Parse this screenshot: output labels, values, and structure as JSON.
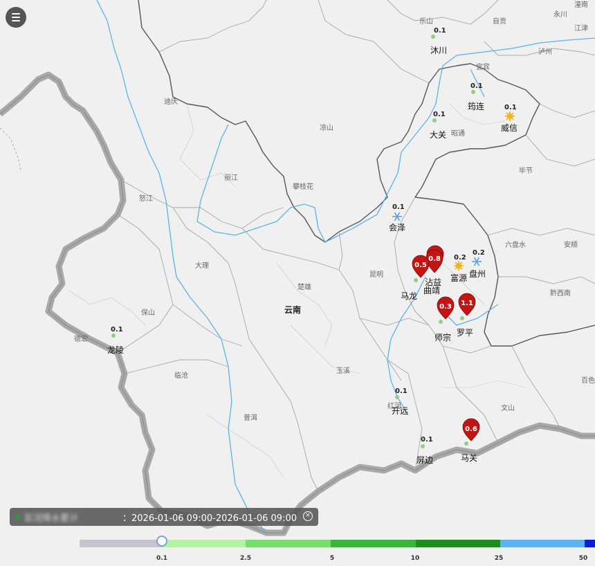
{
  "map": {
    "province_label": "云南",
    "region_labels": [
      {
        "id": "leshan",
        "text": "乐山"
      },
      {
        "id": "zigong",
        "text": "自贡"
      },
      {
        "id": "yongchuan",
        "text": "永川"
      },
      {
        "id": "jiangjin",
        "text": "江津"
      },
      {
        "id": "tongliang",
        "text": "潼南"
      },
      {
        "id": "luzhou",
        "text": "泸州"
      },
      {
        "id": "yibin",
        "text": "宜宾"
      },
      {
        "id": "deqin",
        "text": "迪庆"
      },
      {
        "id": "liangshan",
        "text": "凉山"
      },
      {
        "id": "zhaotong",
        "text": "昭通"
      },
      {
        "id": "bijie",
        "text": "毕节"
      },
      {
        "id": "lijiang",
        "text": "丽江"
      },
      {
        "id": "panzhihua",
        "text": "攀枝花"
      },
      {
        "id": "nujiang",
        "text": "怒江"
      },
      {
        "id": "liupanshui",
        "text": "六盘水"
      },
      {
        "id": "anshun",
        "text": "安顺"
      },
      {
        "id": "dali",
        "text": "大理"
      },
      {
        "id": "chuxiong",
        "text": "楚雄"
      },
      {
        "id": "kunming",
        "text": "昆明"
      },
      {
        "id": "qianxinan",
        "text": "黔西南"
      },
      {
        "id": "dehong",
        "text": "德宏"
      },
      {
        "id": "baoshan",
        "text": "保山"
      },
      {
        "id": "lincang",
        "text": "临沧"
      },
      {
        "id": "yuxi",
        "text": "玉溪"
      },
      {
        "id": "honghe",
        "text": "红河"
      },
      {
        "id": "puer",
        "text": "普洱"
      },
      {
        "id": "wenshan",
        "text": "文山"
      },
      {
        "id": "baise",
        "text": "百色"
      }
    ],
    "stations": [
      {
        "id": "muchuan",
        "name": "沐川",
        "value": "0.1",
        "marker": "dot"
      },
      {
        "id": "junlian",
        "name": "筠连",
        "value": "0.1",
        "marker": "dot"
      },
      {
        "id": "weixin",
        "name": "威信",
        "value": "0.1",
        "marker": "sun"
      },
      {
        "id": "daguan",
        "name": "大关",
        "value": "0.1",
        "marker": "dot"
      },
      {
        "id": "huize",
        "name": "会泽",
        "value": "0.1",
        "marker": "snow"
      },
      {
        "id": "fuyuan",
        "name": "富源",
        "value": "0.2",
        "marker": "sun"
      },
      {
        "id": "panzhou",
        "name": "盘州",
        "value": "0.2",
        "marker": "snow"
      },
      {
        "id": "zhanyi",
        "name": "沾益",
        "value": "0.8",
        "marker": "pin"
      },
      {
        "id": "qujing",
        "name": "曲靖",
        "value": "",
        "marker": "pin"
      },
      {
        "id": "malong",
        "name": "马龙",
        "value": "0.5",
        "marker": "pin"
      },
      {
        "id": "shizong",
        "name": "师宗",
        "value": "0.3",
        "marker": "pin"
      },
      {
        "id": "luoping",
        "name": "罗平",
        "value": "1.1",
        "marker": "pin"
      },
      {
        "id": "longling",
        "name": "龙陵",
        "value": "0.1",
        "marker": "dot"
      },
      {
        "id": "kaiyuan",
        "name": "开远",
        "value": "0.1",
        "marker": "dot"
      },
      {
        "id": "pingbian",
        "name": "屏边",
        "value": "0.1",
        "marker": "dot"
      },
      {
        "id": "maguan",
        "name": "马关",
        "value": "0.6",
        "marker": "pin"
      }
    ]
  },
  "status": {
    "label": "实况降水累计",
    "time_range": "：2026-01-06 09:00-2026-01-06 09:00"
  },
  "legend": {
    "colors": [
      "#c3c7cd",
      "#b5f0a6",
      "#78dc6e",
      "#3cb53c",
      "#218a21",
      "#5eb3ee",
      "#0a20d8"
    ],
    "labels": [
      "0.1",
      "2.5",
      "5",
      "10",
      "25",
      "50"
    ],
    "selected": "0.1"
  },
  "colors": {
    "pin": "#c41414",
    "river": "#5ab4e6",
    "border": "#8d8d8d",
    "land": "#f2f2f2"
  }
}
